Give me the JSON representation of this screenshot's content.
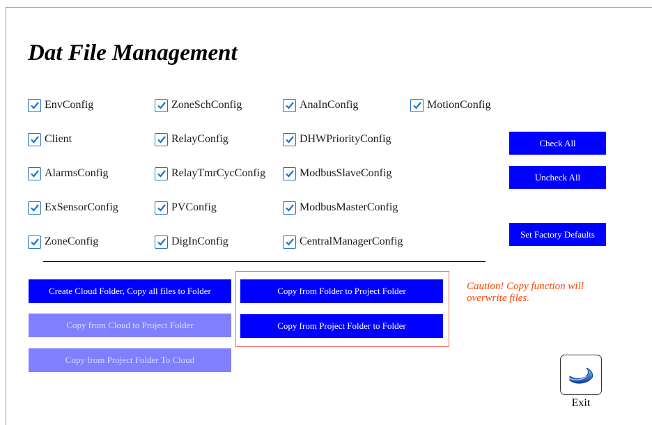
{
  "title": "Dat File Management",
  "checkboxes": [
    {
      "label": "EnvConfig",
      "checked": true
    },
    {
      "label": "ZoneSchConfig",
      "checked": true
    },
    {
      "label": "AnaInConfig",
      "checked": true
    },
    {
      "label": "MotionConfig",
      "checked": true
    },
    {
      "label": "Client",
      "checked": true
    },
    {
      "label": "RelayConfig",
      "checked": true
    },
    {
      "label": "DHWPriorityConfig",
      "checked": true
    },
    {
      "label": "AlarmsConfig",
      "checked": true
    },
    {
      "label": "RelayTmrCycConfig",
      "checked": true
    },
    {
      "label": "ModbusSlaveConfig",
      "checked": true
    },
    {
      "label": "ExSensorConfig",
      "checked": true
    },
    {
      "label": "PVConfig",
      "checked": true
    },
    {
      "label": "ModbusMasterConfig",
      "checked": true
    },
    {
      "label": "ZoneConfig",
      "checked": true
    },
    {
      "label": "DigInConfig",
      "checked": true
    },
    {
      "label": "CentralManagerConfig",
      "checked": true
    }
  ],
  "buttons": {
    "check_all": "Check All",
    "uncheck_all": "Uncheck All",
    "set_factory_defaults": "Set Factory Defaults",
    "create_cloud_folder": "Create Cloud Folder, Copy all files to Folder",
    "copy_cloud_to_project": "Copy from Cloud to Project Folder",
    "copy_project_to_cloud": "Copy from Project Folder To Cloud",
    "copy_folder_to_project": "Copy from Folder to Project Folder",
    "copy_project_to_folder": "Copy from Project Folder to Folder"
  },
  "caution": "Caution! Copy function will overwrite files.",
  "exit_label": "Exit",
  "colors": {
    "button": "#0000ff",
    "button_disabled": "#8080ff",
    "caution": "#ff4500",
    "checkbox": "#1f72c8"
  }
}
